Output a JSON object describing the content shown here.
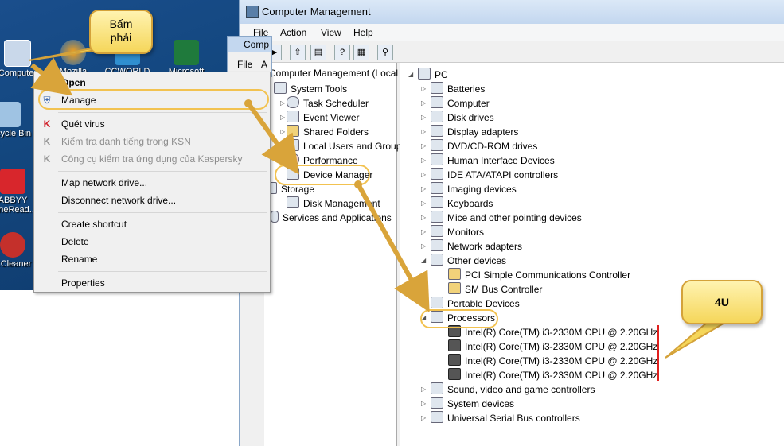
{
  "desktop": {
    "icons": [
      {
        "label": "Computer"
      },
      {
        "label": "Mozilla"
      },
      {
        "label": "CCWORLD"
      },
      {
        "label": "Microsoft"
      },
      {
        "label": "Recycle Bin"
      },
      {
        "label": "ABBYY FineRead.."
      },
      {
        "label": "CCleaner"
      }
    ]
  },
  "context_menu": {
    "items": [
      {
        "label": "Open",
        "enabled": true
      },
      {
        "label": "Manage",
        "enabled": true
      },
      {
        "label": "Quét virus",
        "enabled": true
      },
      {
        "label": "Kiểm tra danh tiếng trong KSN",
        "enabled": false
      },
      {
        "label": "Công cụ kiểm tra ứng dụng của Kaspersky",
        "enabled": false
      },
      {
        "label": "Map network drive...",
        "enabled": true
      },
      {
        "label": "Disconnect network drive...",
        "enabled": true
      },
      {
        "label": "Create shortcut",
        "enabled": true
      },
      {
        "label": "Delete",
        "enabled": true
      },
      {
        "label": "Rename",
        "enabled": true
      },
      {
        "label": "Properties",
        "enabled": true
      }
    ]
  },
  "small_window": {
    "title": "Comp",
    "menu": [
      "File",
      "A"
    ]
  },
  "window": {
    "title": "Computer Management",
    "menu": [
      "File",
      "Action",
      "View",
      "Help"
    ]
  },
  "left_tree": [
    {
      "label": "Computer Management (Local"
    },
    {
      "label": "System Tools"
    },
    {
      "label": "Task Scheduler"
    },
    {
      "label": "Event Viewer"
    },
    {
      "label": "Shared Folders"
    },
    {
      "label": "Local Users and Groups"
    },
    {
      "label": "Performance"
    },
    {
      "label": "Device Manager"
    },
    {
      "label": "Storage"
    },
    {
      "label": "Disk Management"
    },
    {
      "label": "Services and Applications"
    }
  ],
  "device_tree": [
    {
      "label": "PC",
      "level": 0
    },
    {
      "label": "Batteries",
      "level": 1
    },
    {
      "label": "Computer",
      "level": 1
    },
    {
      "label": "Disk drives",
      "level": 1
    },
    {
      "label": "Display adapters",
      "level": 1
    },
    {
      "label": "DVD/CD-ROM drives",
      "level": 1
    },
    {
      "label": "Human Interface Devices",
      "level": 1
    },
    {
      "label": "IDE ATA/ATAPI controllers",
      "level": 1
    },
    {
      "label": "Imaging devices",
      "level": 1
    },
    {
      "label": "Keyboards",
      "level": 1
    },
    {
      "label": "Mice and other pointing devices",
      "level": 1
    },
    {
      "label": "Monitors",
      "level": 1
    },
    {
      "label": "Network adapters",
      "level": 1
    },
    {
      "label": "Other devices",
      "level": 1
    },
    {
      "label": "PCI Simple Communications Controller",
      "level": 2
    },
    {
      "label": "SM Bus Controller",
      "level": 2
    },
    {
      "label": "Portable Devices",
      "level": 1
    },
    {
      "label": "Processors",
      "level": 1
    },
    {
      "label": "Intel(R) Core(TM) i3-2330M CPU @ 2.20GHz",
      "level": 2
    },
    {
      "label": "Intel(R) Core(TM) i3-2330M CPU @ 2.20GHz",
      "level": 2
    },
    {
      "label": "Intel(R) Core(TM) i3-2330M CPU @ 2.20GHz",
      "level": 2
    },
    {
      "label": "Intel(R) Core(TM) i3-2330M CPU @ 2.20GHz",
      "level": 2
    },
    {
      "label": "Sound, video and game controllers",
      "level": 1
    },
    {
      "label": "System devices",
      "level": 1
    },
    {
      "label": "Universal Serial Bus controllers",
      "level": 1
    }
  ],
  "callouts": {
    "right_click": "Bấm phải",
    "cores": "4U"
  },
  "colors": {
    "highlight": "#f2c250",
    "arrow": "#d9a43a",
    "marker": "#e0201e",
    "desktop": "#13477f"
  }
}
